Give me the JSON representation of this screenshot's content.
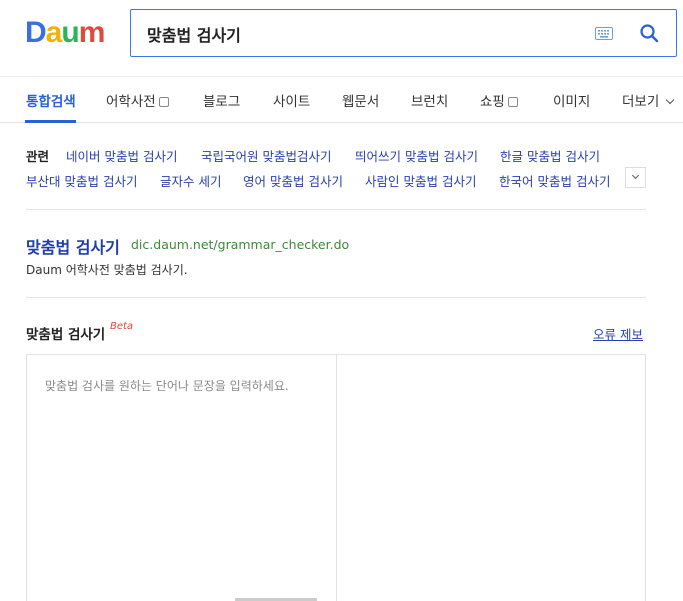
{
  "logo": {
    "d": "D",
    "a": "a",
    "u": "u",
    "m": "m"
  },
  "search": {
    "value": "맞춤법 검사기"
  },
  "tabs": [
    {
      "label": "통합검색",
      "active": true
    },
    {
      "label": "어학사전"
    },
    {
      "label": "블로그"
    },
    {
      "label": "사이트"
    },
    {
      "label": "웹문서"
    },
    {
      "label": "브런치"
    },
    {
      "label": "쇼핑"
    },
    {
      "label": "이미지"
    },
    {
      "label": "더보기"
    }
  ],
  "related": {
    "label": "관련",
    "items": [
      "네이버 맞춤법 검사기",
      "국립국어원 맞춤법검사기",
      "띄어쓰기 맞춤법 검사기",
      "한글 맞춤법 검사기",
      "부산대 맞춤법 검사기",
      "글자수 세기",
      "영어 맞춤법 검사기",
      "사람인 맞춤법 검사기",
      "한국어 맞춤법 검사기"
    ]
  },
  "result": {
    "title": "맞춤법 검사기",
    "url": "dic.daum.net/grammar_checker.do",
    "desc": "Daum 어학사전 맞춤법 검사기."
  },
  "checker": {
    "title": "맞춤법 검사기",
    "beta": "Beta",
    "report": "오류 제보",
    "placeholder": "맞춤법 검사를 원하는 단어나 문장을 입력하세요."
  }
}
